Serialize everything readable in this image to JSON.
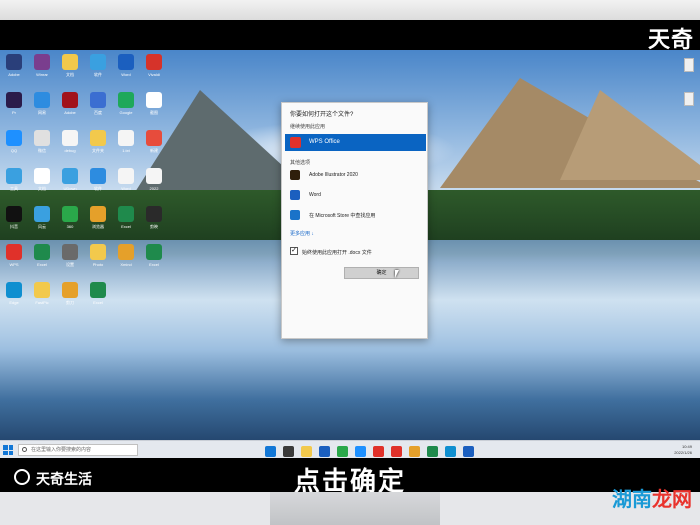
{
  "brand": {
    "top_logo": "天奇",
    "bottom_logo": "天奇生活"
  },
  "subtitle": "点击确定",
  "watermark": {
    "part1": "湖南",
    "part2": "龙网"
  },
  "dialog": {
    "title": "你要如何打开这个文件?",
    "continue_label": "继续使用此应用",
    "selected_app": "WPS Office",
    "other_label": "其他选项",
    "options": [
      {
        "name": "Adobe Illustrator 2020",
        "icon": "illustrator-icon",
        "color": "#2f1f0c"
      },
      {
        "name": "Word",
        "icon": "word-icon",
        "color": "#1b5fbf"
      },
      {
        "name": "在 Microsoft Store 中查找应用",
        "icon": "store-icon",
        "color": "#1a73c9"
      }
    ],
    "more_apps": "更多应用 ↓",
    "always_use": "始终使用此应用打开 .docx 文件",
    "checkbox_mark": "✓",
    "ok_label": "确定"
  },
  "desktop_icons": [
    {
      "label": "Adobe",
      "color": "#2a3f7a"
    },
    {
      "label": "Winrar",
      "color": "#7a3e8e"
    },
    {
      "label": "文档",
      "color": "#f2c94c"
    },
    {
      "label": "软件",
      "color": "#3aa0e0"
    },
    {
      "label": "Word",
      "color": "#1b5fbf"
    },
    {
      "label": "Vivaldi",
      "color": "#d6332a"
    },
    {
      "label": "Pr",
      "color": "#2b1b4a"
    },
    {
      "label": "网易",
      "color": "#2d8ce0"
    },
    {
      "label": "Adobe",
      "color": "#a1121b"
    },
    {
      "label": "百度",
      "color": "#3b6ed1"
    },
    {
      "label": "Google",
      "color": "#1fa85a"
    },
    {
      "label": "截图",
      "color": "#ffffff"
    },
    {
      "label": "QQ",
      "color": "#1e90ff"
    },
    {
      "label": "微信",
      "color": "#e0e0e0"
    },
    {
      "label": "debug",
      "color": "#f5f5f5"
    },
    {
      "label": "文件夹",
      "color": "#f2c94c"
    },
    {
      "label": "1.txt",
      "color": "#f5f5f5"
    },
    {
      "label": "新建",
      "color": "#e74c3c"
    },
    {
      "label": "工具",
      "color": "#3aa0e0"
    },
    {
      "label": "文档",
      "color": "#ffffff"
    },
    {
      "label": "UDown",
      "color": "#3aa0e0"
    },
    {
      "label": "软件",
      "color": "#2d8ce0"
    },
    {
      "label": "Word",
      "color": "#f5f5f5"
    },
    {
      "label": "2022",
      "color": "#f5f5f5"
    },
    {
      "label": "抖音",
      "color": "#111111"
    },
    {
      "label": "风云",
      "color": "#3aa0e0"
    },
    {
      "label": "360",
      "color": "#2aa84a"
    },
    {
      "label": "浏览器",
      "color": "#e5a02a"
    },
    {
      "label": "Excel",
      "color": "#1f8a4c"
    },
    {
      "label": "剪映",
      "color": "#2a2a2a"
    },
    {
      "label": "WPS",
      "color": "#e0312a"
    },
    {
      "label": "Excel",
      "color": "#1f8a4c"
    },
    {
      "label": "设置",
      "color": "#6a6a6a"
    },
    {
      "label": "Photo",
      "color": "#f2c94c"
    },
    {
      "label": "Xmind",
      "color": "#e5a02a"
    },
    {
      "label": "Excel",
      "color": "#1f8a4c"
    },
    {
      "label": "Edge",
      "color": "#0f8fd0"
    },
    {
      "label": "FastPic",
      "color": "#f2c94c"
    },
    {
      "label": "剪刀",
      "color": "#e5a02a"
    },
    {
      "label": "Excel",
      "color": "#1f8a4c"
    }
  ],
  "taskbar": {
    "search_placeholder": "在这里输入你要搜索的内容",
    "time": "10:49",
    "date": "2022/1/26",
    "apps": [
      "#1277d6",
      "#3a3a3a",
      "#f2c94c",
      "#1b5fbf",
      "#2aa84a",
      "#1e90ff",
      "#e0312a",
      "#e0312a",
      "#e5a02a",
      "#1f8a4c",
      "#0f8fd0",
      "#1b5fbf"
    ]
  }
}
